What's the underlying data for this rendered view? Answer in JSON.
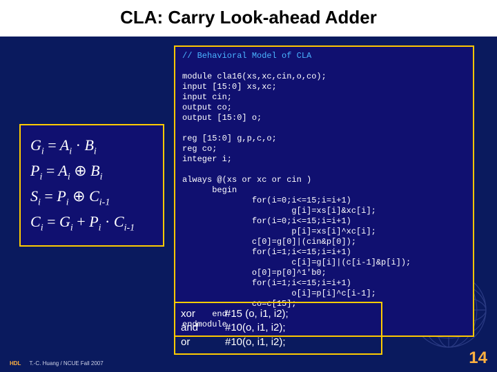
{
  "title": "CLA: Carry Look-ahead Adder",
  "code": {
    "comment": "// Behavioral Model of CLA",
    "blank": " ",
    "l1": "module cla16(xs,xc,cin,o,co);",
    "l2": "input [15:0] xs,xc;",
    "l3": "input cin;",
    "l4": "output co;",
    "l5": "output [15:0] o;",
    "l6": " ",
    "l7": "reg [15:0] g,p,c,o;",
    "l8": "reg co;",
    "l9": "integer i;",
    "l10": " ",
    "l11": "always @(xs or xc or cin )",
    "l12": "      begin",
    "l13": "              for(i=0;i<=15;i=i+1)",
    "l14": "                      g[i]=xs[i]&xc[i];",
    "l15": "              for(i=0;i<=15;i=i+1)",
    "l16": "                      p[i]=xs[i]^xc[i];",
    "l17": "              c[0]=g[0]|(cin&p[0]);",
    "l18": "              for(i=1;i<=15;i=i+1)",
    "l19": "                      c[i]=g[i]|(c[i-1]&p[i]);",
    "l20": "              o[0]=p[0]^1'b0;",
    "l21": "              for(i=1;i<=15;i=i+1)",
    "l22": "                      o[i]=p[i]^c[i-1];",
    "l23": "              co=c[15];",
    "l24": "      end",
    "l25": "endmodule"
  },
  "gates": {
    "r1g": "xor",
    "r1t": "#15 (o, i1, i2);",
    "r2g": "and",
    "r2t": "#10(o, i1, i2);",
    "r3g": "or",
    "r3t": "#10(o, i1, i2);"
  },
  "footer": {
    "hdl": "HDL",
    "rest": "T.-C. Huang / NCUE  Fall 2007"
  },
  "pagenum": "14"
}
